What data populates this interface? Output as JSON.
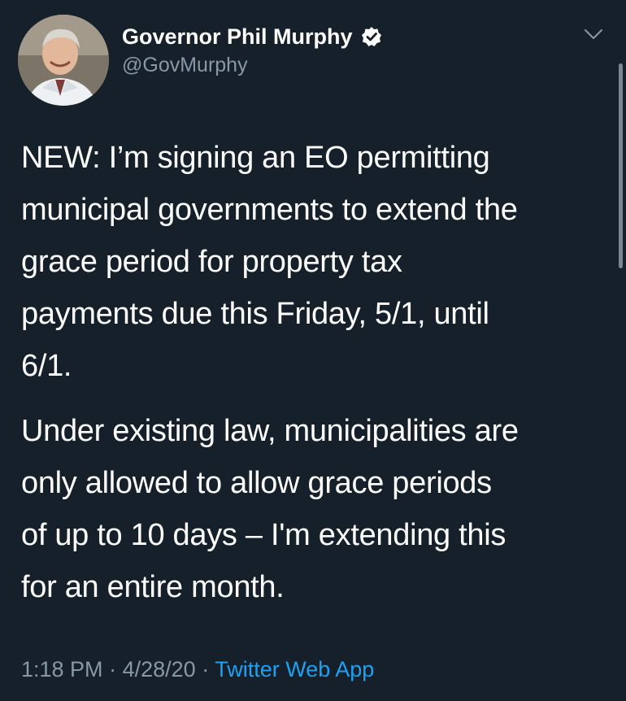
{
  "author": {
    "display_name": "Governor Phil Murphy",
    "handle": "@GovMurphy",
    "verified": true,
    "verified_icon": "verified-badge-icon",
    "avatar": "profile-photo"
  },
  "menu": {
    "icon": "chevron-down-icon"
  },
  "tweet": {
    "paragraphs": [
      {
        "lines": [
          "NEW: I’m signing an EO permitting",
          "municipal governments to extend the",
          "grace period for property tax",
          "payments due this Friday, 5/1, until",
          "6/1."
        ]
      },
      {
        "lines": [
          "Under existing law, municipalities are",
          "only allowed to allow grace periods",
          "of up to 10 days – I'm extending this",
          "for an entire month."
        ]
      }
    ]
  },
  "meta": {
    "time": "1:18 PM",
    "separator": "·",
    "date": "4/28/20",
    "source": "Twitter Web App"
  },
  "colors": {
    "background": "#15202b",
    "text": "#ffffff",
    "secondary_text": "#8899a6",
    "link": "#1da1f2"
  }
}
